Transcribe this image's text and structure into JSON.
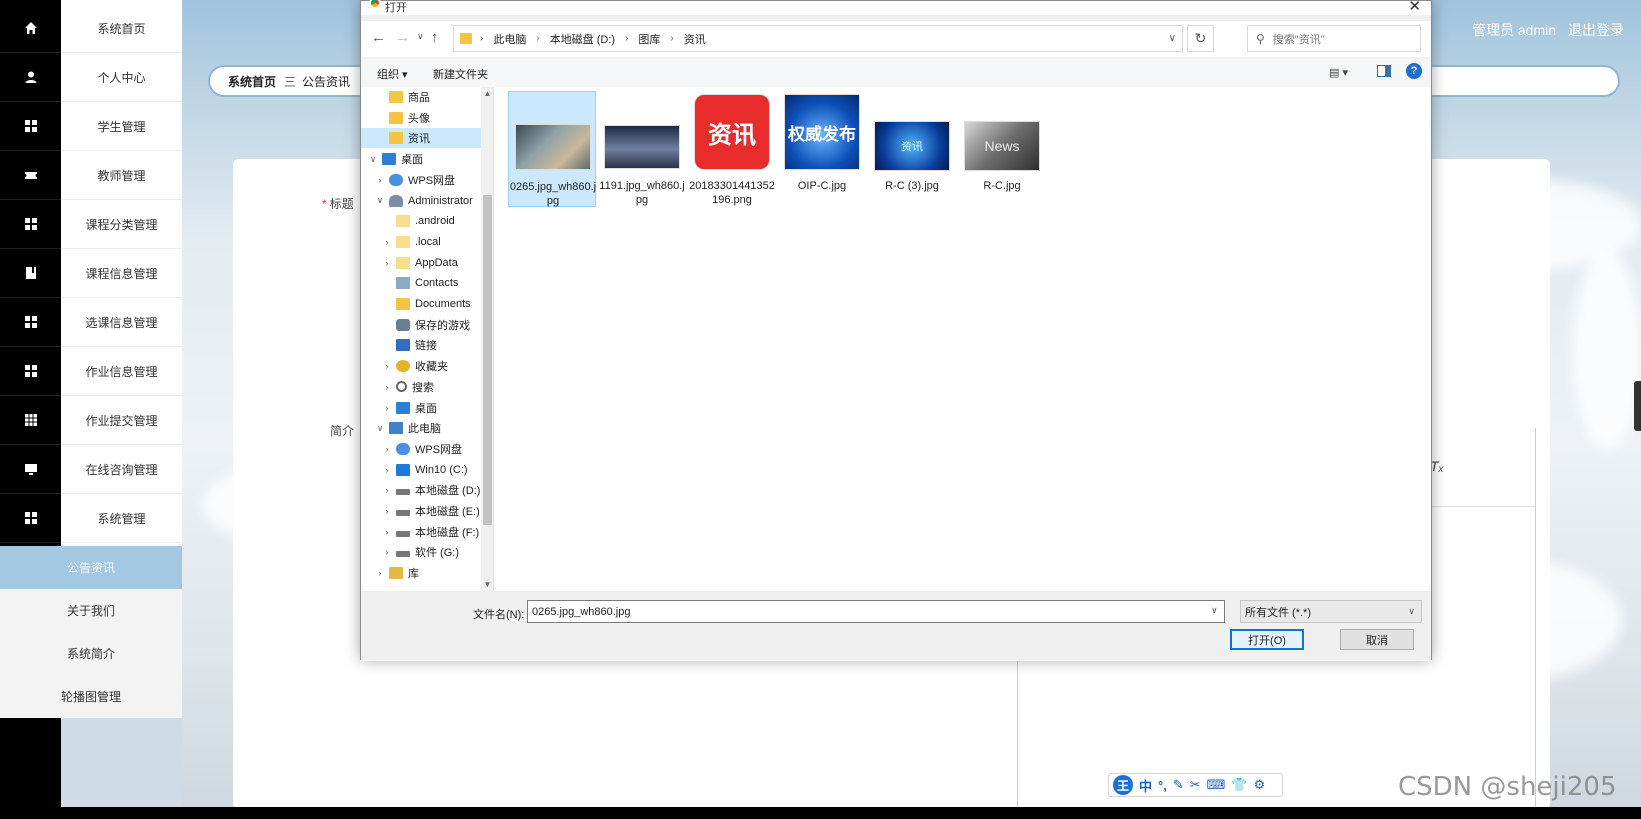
{
  "app": {
    "menu": [
      "系统首页",
      "个人中心",
      "学生管理",
      "教师管理",
      "课程分类管理",
      "课程信息管理",
      "选课信息管理",
      "作业信息管理",
      "作业提交管理",
      "在线咨询管理",
      "系统管理"
    ],
    "rail_icons": [
      "home-icon",
      "user-icon",
      "grid-icon",
      "ticket-icon",
      "grid-icon",
      "book-icon",
      "grid-icon",
      "grid-icon",
      "table-icon",
      "monitor-icon",
      "grid-icon"
    ],
    "submenu": [
      "公告资讯",
      "关于我们",
      "系统简介",
      "轮播图管理"
    ],
    "submenu_active": "公告资讯",
    "user_label": "管理员 admin",
    "logout_label": "退出登录",
    "breadcrumb": {
      "home": "系统首页",
      "sep": "三",
      "current": "公告资讯"
    },
    "form": {
      "title_label": "标题",
      "required_mark": "*",
      "intro_label": "简介",
      "clear_format_glyph": "Tₓ"
    },
    "colors": {
      "accent": "#a3c8e2",
      "rail_bg": "#000000",
      "primary_button": "#0078d7"
    }
  },
  "dialog": {
    "title": "打开",
    "close_glyph": "✕",
    "address": [
      "此电脑",
      "本地磁盘 (D:)",
      "图库",
      "资讯"
    ],
    "search_placeholder": "搜索\"资讯\"",
    "toolbar": {
      "organize": "组织 ▾",
      "new_folder": "新建文件夹"
    },
    "tree": [
      {
        "label": "商品",
        "icon": "folder",
        "indent": 1,
        "arrow": ""
      },
      {
        "label": "头像",
        "icon": "folder",
        "indent": 1,
        "arrow": ""
      },
      {
        "label": "资讯",
        "icon": "folder",
        "indent": 1,
        "arrow": "",
        "selected": true
      },
      {
        "label": "桌面",
        "icon": "desk",
        "indent": 0,
        "arrow": "∨"
      },
      {
        "label": "WPS网盘",
        "icon": "cloud",
        "indent": 1,
        "arrow": "›"
      },
      {
        "label": "Administrator",
        "icon": "user",
        "indent": 1,
        "arrow": "∨"
      },
      {
        "label": ".android",
        "icon": "folder-pale",
        "indent": 2,
        "arrow": ""
      },
      {
        "label": ".local",
        "icon": "folder-pale",
        "indent": 2,
        "arrow": "›"
      },
      {
        "label": "AppData",
        "icon": "folder-pale",
        "indent": 2,
        "arrow": "›"
      },
      {
        "label": "Contacts",
        "icon": "contact",
        "indent": 2,
        "arrow": ""
      },
      {
        "label": "Documents",
        "icon": "folder",
        "indent": 2,
        "arrow": ""
      },
      {
        "label": "保存的游戏",
        "icon": "game",
        "indent": 2,
        "arrow": ""
      },
      {
        "label": "链接",
        "icon": "link",
        "indent": 2,
        "arrow": ""
      },
      {
        "label": "收藏夹",
        "icon": "star",
        "indent": 2,
        "arrow": "›"
      },
      {
        "label": "搜索",
        "icon": "search",
        "indent": 2,
        "arrow": "›"
      },
      {
        "label": "桌面",
        "icon": "desk",
        "indent": 2,
        "arrow": "›"
      },
      {
        "label": "此电脑",
        "icon": "pc",
        "indent": 1,
        "arrow": "∨"
      },
      {
        "label": "WPS网盘",
        "icon": "cloud",
        "indent": 2,
        "arrow": "›"
      },
      {
        "label": "Win10 (C:)",
        "icon": "win",
        "indent": 2,
        "arrow": "›"
      },
      {
        "label": "本地磁盘 (D:)",
        "icon": "drive",
        "indent": 2,
        "arrow": "›"
      },
      {
        "label": "本地磁盘 (E:)",
        "icon": "drive",
        "indent": 2,
        "arrow": "›"
      },
      {
        "label": "本地磁盘 (F:)",
        "icon": "drive",
        "indent": 2,
        "arrow": "›"
      },
      {
        "label": "软件 (G:)",
        "icon": "drive",
        "indent": 2,
        "arrow": "›"
      },
      {
        "label": "库",
        "icon": "lib",
        "indent": 1,
        "arrow": "›"
      }
    ],
    "files": [
      {
        "name": "0265.jpg_wh860.jpg",
        "thumb_text": "",
        "selected": true
      },
      {
        "name": "1191.jpg_wh860.jpg",
        "thumb_text": ""
      },
      {
        "name": "20183301441352196.png",
        "thumb_text": "资讯"
      },
      {
        "name": "OIP-C.jpg",
        "thumb_text": "权威发布"
      },
      {
        "name": "R-C (3).jpg",
        "thumb_text": "资讯"
      },
      {
        "name": "R-C.jpg",
        "thumb_text": "News"
      }
    ],
    "filename_label": "文件名(N):",
    "filename_value": "0265.jpg_wh860.jpg",
    "filetype": "所有文件 (*.*)",
    "open_button": "打开(O)",
    "cancel_button": "取消"
  },
  "ime": {
    "logo": "王",
    "items": [
      "中",
      "°,",
      "✎",
      "✂",
      "⌨",
      "👕",
      "⚙"
    ]
  },
  "watermark": "CSDN @sheji205"
}
